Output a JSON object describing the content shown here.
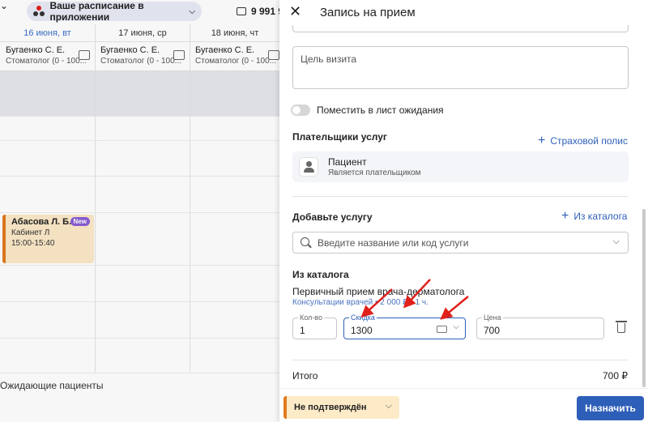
{
  "background": {
    "schedule_pill": "Ваше расписание в приложении",
    "phone": "9 991 9",
    "days": [
      {
        "label": "16 июня, вт",
        "today": true
      },
      {
        "label": "17 июня, ср",
        "today": false
      },
      {
        "label": "18 июня, чт",
        "today": false
      }
    ],
    "doctors": [
      {
        "name": "Бугаенко С. Е.",
        "spec": "Стоматолог (0 - 100..."
      },
      {
        "name": "Бугаенко С. Е.",
        "spec": "Стоматолог (0 - 100..."
      },
      {
        "name": "Бугаенко С. Е.",
        "spec": "Стоматолог (0 - 100..."
      }
    ],
    "appointment": {
      "name": "Абасова Л. Б.",
      "badge": "New",
      "cabinet": "Кабинет Л",
      "time": "15:00-15:40"
    },
    "waiting_label": "Ожидающие пациенты"
  },
  "drawer": {
    "title": "Запись на прием",
    "purpose_placeholder": "Цель визита",
    "waitlist_label": "Поместить в лист ожидания",
    "payers": {
      "title": "Плательщики услуг",
      "add_link": "Страховой полис",
      "payer_name": "Пациент",
      "payer_sub": "Является плательщиком"
    },
    "add_service": {
      "title": "Добавьте услугу",
      "catalog_link": "Из каталога",
      "search_placeholder": "Введите название или код услуги"
    },
    "catalog": {
      "title": "Из каталога",
      "service_name": "Первичный прием врача-дерматолога",
      "service_meta": "Консультации врачей • 2 000 ₽ • 1 ч.",
      "qty_label": "Кол-во",
      "qty_value": "1",
      "discount_label": "Скидка",
      "discount_value": "1300",
      "price_label": "Цена",
      "price_value": "700"
    },
    "total_label": "Итого",
    "total_value": "700 ₽",
    "status": "Не подтверждён",
    "submit": "Назначить"
  },
  "colors": {
    "accent": "#2e5fb8",
    "status_orange": "#e07a1f",
    "annotation_red": "#e0201b"
  }
}
